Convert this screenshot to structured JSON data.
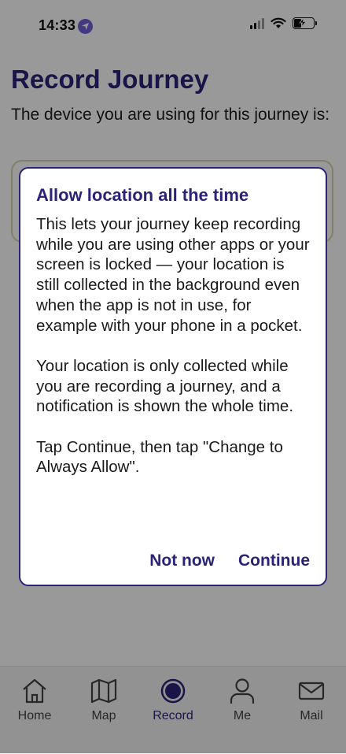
{
  "status_bar": {
    "time": "14:33"
  },
  "page": {
    "title": "Record Journey",
    "subtitle": "The device you are using for this journey is:"
  },
  "tabs": [
    {
      "label": "Home",
      "icon": "home-icon"
    },
    {
      "label": "Map",
      "icon": "map-icon"
    },
    {
      "label": "Record",
      "icon": "record-icon",
      "active": true
    },
    {
      "label": "Me",
      "icon": "person-icon"
    },
    {
      "label": "Mail",
      "icon": "mail-icon"
    }
  ],
  "dialog": {
    "title": "Allow location all the time",
    "body": "This lets your journey keep recording while you are using other apps or your screen is locked — your location is still collected in the background even when the app is not in use, for example with your phone in a pocket.\n\nYour location is only collected while you are recording a journey, and a notification is shown the whole time.\n\nTap Continue, then tap \"Change to Always Allow\".",
    "not_now_label": "Not now",
    "continue_label": "Continue"
  },
  "colors": {
    "accent": "#2a2378",
    "location_badge": "#6f5fd6",
    "tab_bar_bg": "#f4f4f4",
    "overlay": "rgba(0,0,0,0.4)"
  }
}
